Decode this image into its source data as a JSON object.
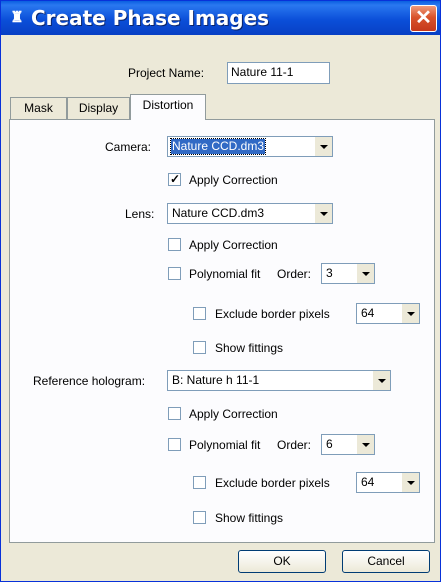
{
  "window": {
    "title": "Create Phase Images",
    "app_icon": "app-icon",
    "close_glyph": "✕"
  },
  "project": {
    "label": "Project Name:",
    "value": "Nature 11-1"
  },
  "tabs": [
    {
      "label": "Mask",
      "active": false
    },
    {
      "label": "Display",
      "active": false
    },
    {
      "label": "Distortion",
      "active": true
    }
  ],
  "camera": {
    "label": "Camera:",
    "value": "Nature CCD.dm3",
    "apply_correction": {
      "label": "Apply Correction",
      "checked": true
    }
  },
  "lens": {
    "label": "Lens:",
    "value": "Nature CCD.dm3",
    "apply_correction": {
      "label": "Apply Correction",
      "checked": false
    },
    "polynomial_fit": {
      "label": "Polynomial fit",
      "checked": false
    },
    "order_label": "Order:",
    "order_value": "3",
    "exclude_border": {
      "label": "Exclude border pixels",
      "checked": false
    },
    "border_value": "64",
    "show_fittings": {
      "label": "Show fittings",
      "checked": false
    }
  },
  "reference": {
    "label": "Reference hologram:",
    "value": "B: Nature h 11-1",
    "apply_correction": {
      "label": "Apply Correction",
      "checked": false
    },
    "polynomial_fit": {
      "label": "Polynomial fit",
      "checked": false
    },
    "order_label": "Order:",
    "order_value": "6",
    "exclude_border": {
      "label": "Exclude border pixels",
      "checked": false
    },
    "border_value": "64",
    "show_fittings": {
      "label": "Show fittings",
      "checked": false
    }
  },
  "buttons": {
    "ok": "OK",
    "cancel": "Cancel"
  },
  "colors": {
    "titlebar": "#0b4fd9",
    "close": "#d8532b",
    "dialog_bg": "#ece9d8",
    "selection": "#316ac5"
  }
}
